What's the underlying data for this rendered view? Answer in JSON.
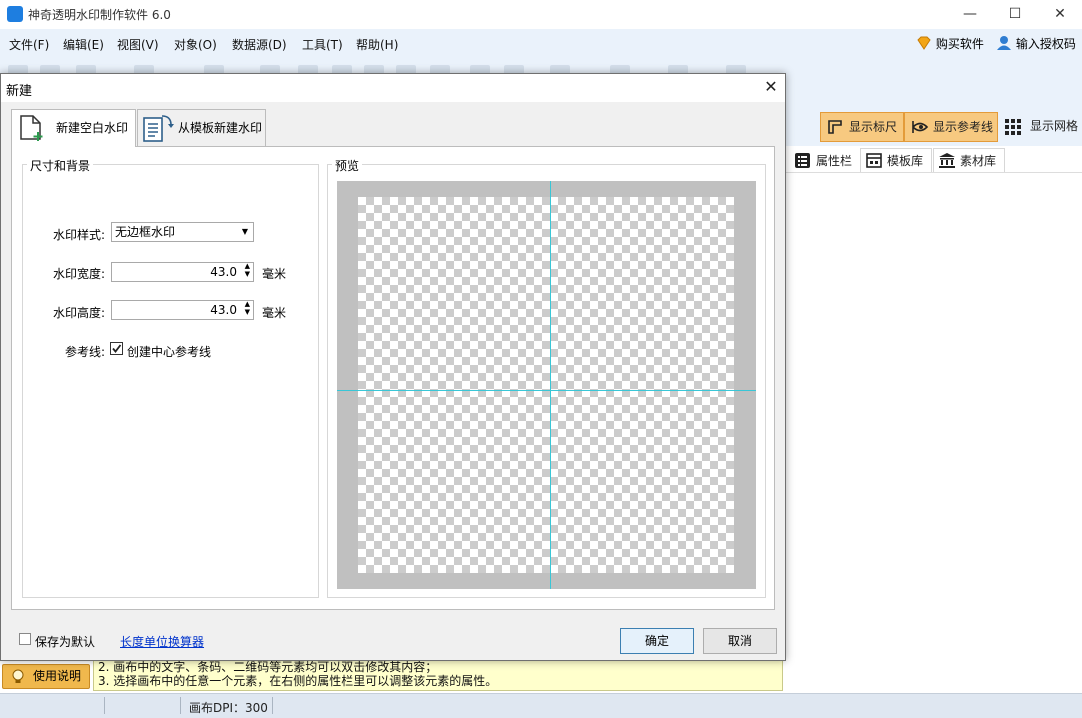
{
  "app": {
    "icon_text": "神奇 水印",
    "title": "神奇透明水印制作软件 6.0"
  },
  "window_controls": {
    "minimize": "—",
    "maximize": "☐",
    "close": "✕"
  },
  "menu": [
    "文件(F)",
    "编辑(E)",
    "视图(V)",
    "对象(O)",
    "数据源(D)",
    "工具(T)",
    "帮助(H)"
  ],
  "header_right": {
    "buy": "购买软件",
    "license": "输入授权码"
  },
  "viewbar": {
    "show_ruler": "显示标尺",
    "show_guides": "显示参考线",
    "show_grid": "显示网格"
  },
  "side_tabs": [
    "属性栏",
    "模板库",
    "素材库"
  ],
  "guide_button": "使用说明",
  "help_lines": [
    "2. 画布中的文字、条码、二维码等元素均可以双击修改其内容；",
    "3. 选择画布中的任意一个元素，在右侧的属性栏里可以调整该元素的属性。"
  ],
  "status": {
    "dpi": "画布DPI：300"
  },
  "dialog": {
    "title": "新建",
    "close": "✕",
    "tabs": [
      "新建空白水印",
      "从模板新建水印"
    ],
    "group_size_label": "尺寸和背景",
    "group_preview_label": "预览",
    "style_label": "水印样式:",
    "style_value": "无边框水印",
    "width_label": "水印宽度:",
    "width_value": "43.0",
    "height_label": "水印高度:",
    "height_value": "43.0",
    "unit": "毫米",
    "guide_label": "参考线:",
    "guide_checkbox": "创建中心参考线",
    "guide_checked": true,
    "save_default": "保存为默认",
    "unit_converter": "长度单位换算器",
    "ok": "确定",
    "cancel": "取消"
  },
  "colors": {
    "accent": "#1e7ee0",
    "toggle_on": "#f7c980",
    "guide_line": "#39c6d6",
    "link": "#0033cc"
  }
}
